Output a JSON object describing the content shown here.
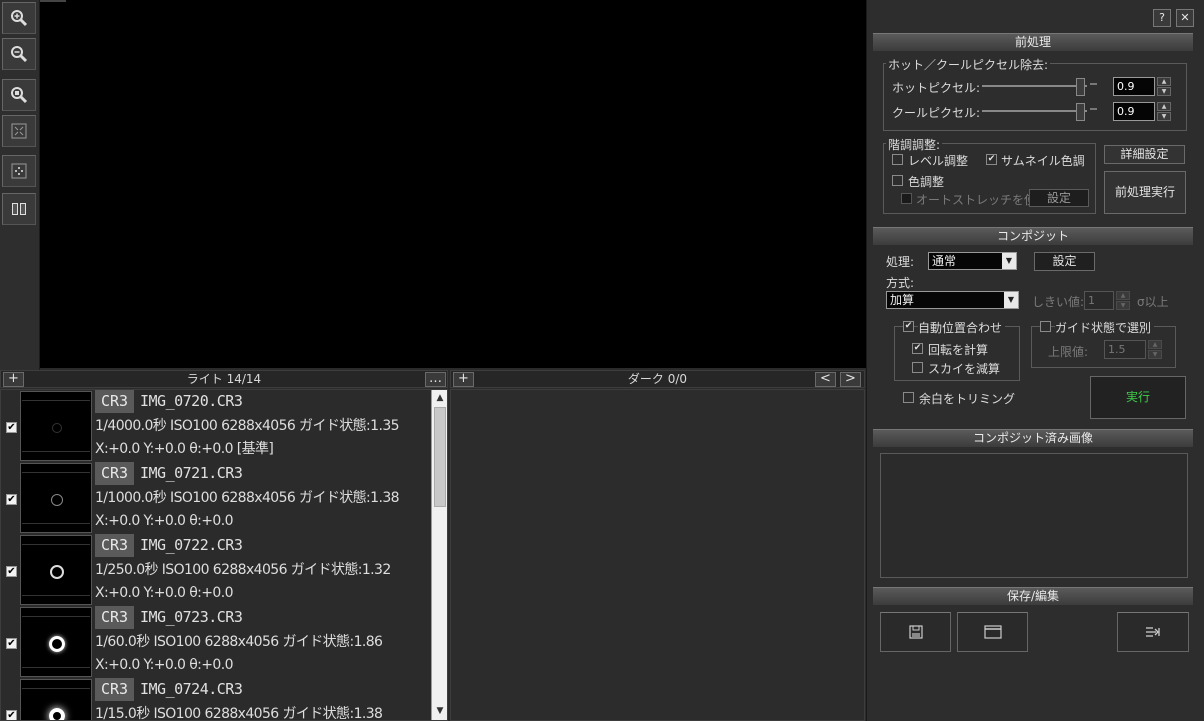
{
  "toolbar": {
    "buttons": [
      "zoom-in",
      "zoom-out",
      "zoom-fit",
      "fullscreen",
      "center",
      "compare"
    ]
  },
  "light_pane": {
    "add": "+",
    "title": "ライト 14/14",
    "more": "…"
  },
  "dark_pane": {
    "add": "+",
    "title": "ダーク 0/0",
    "prev": "<",
    "next": ">"
  },
  "rows": [
    {
      "checked": "✔",
      "format": "CR3",
      "name": "IMG_0720.CR3",
      "info": "1/4000.0秒 ISO100 6288x4056 ガイド状態:1.35",
      "pos": "X:+0.0 Y:+0.0 θ:+0.0 [基準]"
    },
    {
      "checked": "✔",
      "format": "CR3",
      "name": "IMG_0721.CR3",
      "info": "1/1000.0秒 ISO100 6288x4056 ガイド状態:1.38",
      "pos": "X:+0.0 Y:+0.0 θ:+0.0"
    },
    {
      "checked": "✔",
      "format": "CR3",
      "name": "IMG_0722.CR3",
      "info": "1/250.0秒 ISO100 6288x4056 ガイド状態:1.32",
      "pos": "X:+0.0 Y:+0.0 θ:+0.0"
    },
    {
      "checked": "✔",
      "format": "CR3",
      "name": "IMG_0723.CR3",
      "info": "1/60.0秒 ISO100 6288x4056 ガイド状態:1.86",
      "pos": "X:+0.0 Y:+0.0 θ:+0.0"
    },
    {
      "checked": "✔",
      "format": "CR3",
      "name": "IMG_0724.CR3",
      "info": "1/15.0秒 ISO100 6288x4056 ガイド状態:1.38",
      "pos": ""
    }
  ],
  "header_buttons": {
    "help": "?",
    "close": "✕"
  },
  "preprocess": {
    "title": "前処理",
    "hotcool_group": "ホット／クールピクセル除去:",
    "hot_label": "ホットピクセル:",
    "hot_value": "0.9",
    "cool_label": "クールピクセル:",
    "cool_value": "0.9",
    "tone_group": "階調調整:",
    "level_label": "レベル調整",
    "level_checked": "",
    "thumb_color_label": "サムネイル色調",
    "thumb_color_checked": "✔",
    "color_label": "色調整",
    "color_checked": "",
    "autostretch_label": "オートストレッチを使う",
    "autostretch_settings": "設定",
    "detail_button": "詳細設定",
    "run_button": "前処理実行"
  },
  "composite": {
    "title": "コンポジット",
    "process_label": "処理:",
    "process_value": "通常",
    "process_settings": "設定",
    "method_label": "方式:",
    "method_value": "加算",
    "threshold_label": "しきい値:",
    "threshold_value": "1",
    "threshold_unit": "σ以上",
    "auto_align_label": "自動位置合わせ",
    "auto_align_checked": "✔",
    "rotation_label": "回転を計算",
    "rotation_checked": "✔",
    "sky_label": "スカイを減算",
    "sky_checked": "",
    "guide_select_label": "ガイド状態で選別",
    "guide_select_checked": "",
    "upper_label": "上限値:",
    "upper_value": "1.5",
    "trim_label": "余白をトリミング",
    "trim_checked": "",
    "run_button": "実行",
    "run_color": "#3fd14a"
  },
  "composited": {
    "title": "コンポジット済み画像"
  },
  "save_edit": {
    "title": "保存/編集"
  }
}
